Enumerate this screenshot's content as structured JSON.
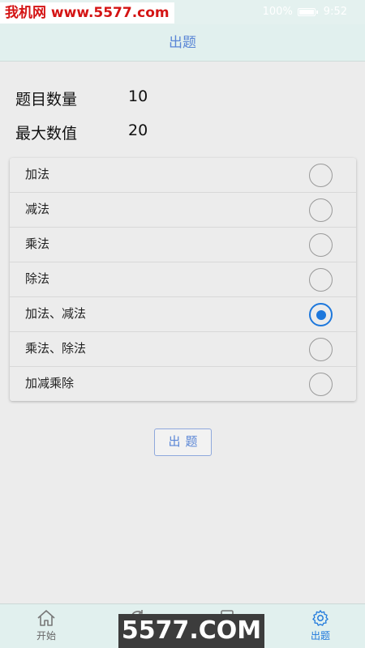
{
  "watermark_top": "我机网 www.5577.com",
  "status": {
    "battery": "100%",
    "time": "9:52"
  },
  "header": {
    "title": "出题"
  },
  "settings": [
    {
      "label": "题目数量",
      "value": "10"
    },
    {
      "label": "最大数值",
      "value": "20"
    }
  ],
  "options": [
    {
      "label": "加法",
      "selected": false
    },
    {
      "label": "减法",
      "selected": false
    },
    {
      "label": "乘法",
      "selected": false
    },
    {
      "label": "除法",
      "selected": false
    },
    {
      "label": "加法、减法",
      "selected": true
    },
    {
      "label": "乘法、除法",
      "selected": false
    },
    {
      "label": "加减乘除",
      "selected": false
    }
  ],
  "submit_label": "出题",
  "tabs": [
    {
      "label": "开始",
      "icon": "home-icon"
    },
    {
      "label": "",
      "icon": "refresh-icon"
    },
    {
      "label": "",
      "icon": "document-icon"
    },
    {
      "label": "出题",
      "icon": "gear-icon",
      "active": true
    }
  ],
  "watermark_bottom": "5577.COM",
  "colors": {
    "accent": "#1e78dc",
    "header_bg": "#e1f0ee",
    "title_text": "#5a86d6"
  }
}
